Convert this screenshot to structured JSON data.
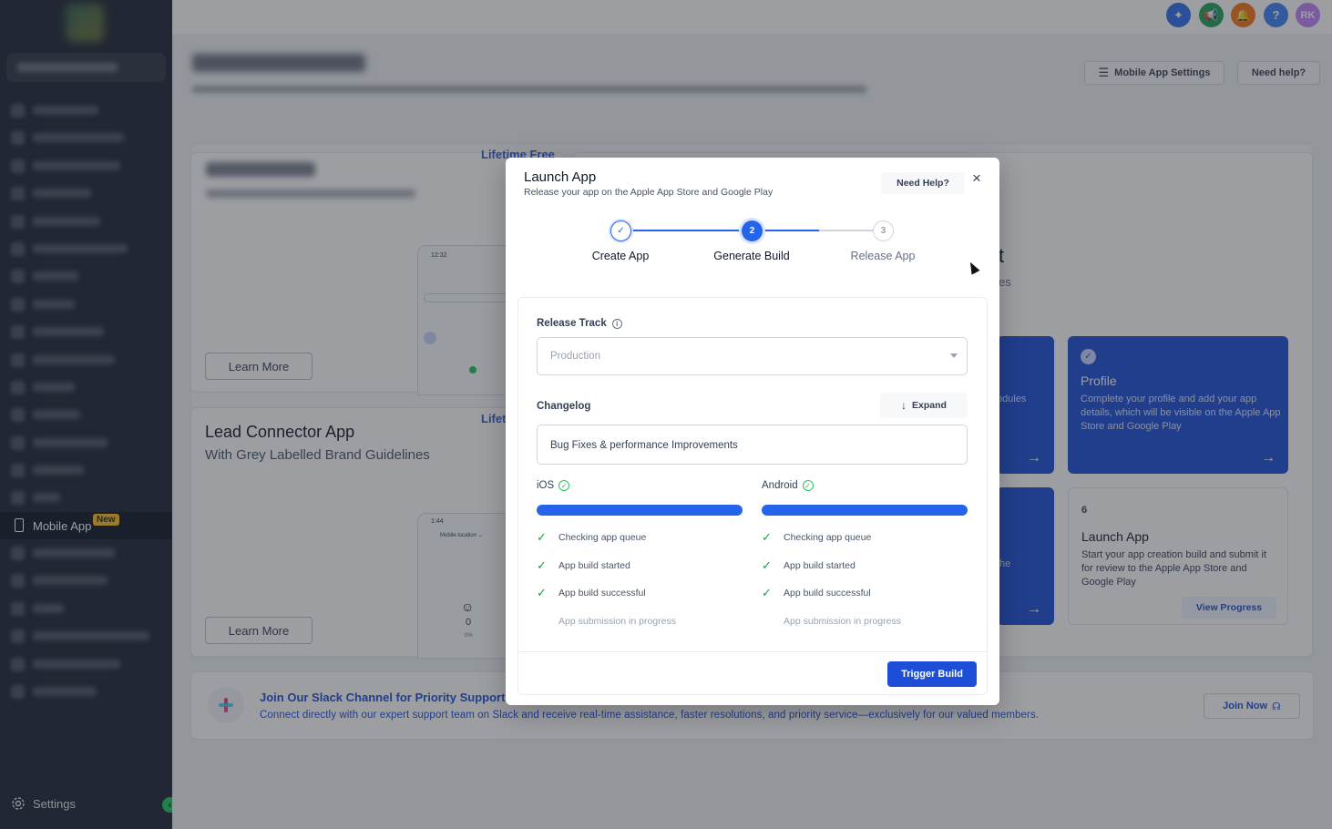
{
  "sidebar": {
    "active_item": {
      "label": "Mobile App",
      "badge": "New"
    },
    "settings_label": "Settings",
    "collapse_icon": "chevron-left-icon"
  },
  "topbar": {
    "avatar_initials": "RK",
    "help_icon": "?"
  },
  "page": {
    "settings_button": "Mobile App Settings",
    "help_button": "Need help?",
    "lifetime_free": "Lifetime Free",
    "lifetime_short": "Lifet",
    "learn_more": "Learn More",
    "learn_more_2": "Learn More",
    "lc_title": "Lead Connector App",
    "lc_subtitle": "With Grey Labelled Brand Guidelines",
    "partial_t": "t",
    "partial_es": "es",
    "partial_modules": "odules",
    "partial_the": "the",
    "phone1_time": "12:32",
    "phone2_time": "1:44",
    "phone2_location": "Mobile location ⌄",
    "phone2_value": "0",
    "phone2_percent": "0%",
    "profile_card": {
      "title": "Profile",
      "desc": "Complete your profile and add your app details, which will be visible on the Apple App Store and Google Play"
    },
    "launch_card": {
      "number": "6",
      "title": "Launch App",
      "desc": "Start your app creation build and submit it for review to the Apple App Store and Google Play",
      "button": "View Progress"
    },
    "slack": {
      "title": "Join Our Slack Channel for Priority Support!",
      "desc": "Connect directly with our expert support team on Slack and receive real-time assistance, faster resolutions, and priority service—exclusively for our valued members.",
      "button": "Join Now"
    }
  },
  "modal": {
    "title": "Launch App",
    "subtitle": "Release your app on the Apple App Store and Google Play",
    "help_button": "Need Help?",
    "close_icon": "×",
    "steps": [
      {
        "label": "Create App",
        "marker": "✓",
        "state": "done"
      },
      {
        "label": "Generate Build",
        "marker": "2",
        "state": "active"
      },
      {
        "label": "Release App",
        "marker": "3",
        "state": "upcoming"
      }
    ],
    "release_track": {
      "label": "Release Track",
      "value": "Production"
    },
    "changelog": {
      "label": "Changelog",
      "expand_button": "Expand",
      "value": "Bug Fixes & performance Improvements"
    },
    "ios": {
      "label": "iOS",
      "progress": 1.0,
      "items": [
        "Checking app queue",
        "App build started",
        "App build successful",
        "App submission in progress"
      ]
    },
    "android": {
      "label": "Android",
      "progress": 1.0,
      "items": [
        "Checking app queue",
        "App build started",
        "App build successful",
        "App submission in progress"
      ]
    },
    "trigger_button": "Trigger Build"
  },
  "colors": {
    "primary": "#1d4ed8",
    "progress": "#2563eb",
    "success": "#22c55e",
    "sidebar_bg": "#1c2434",
    "new_badge": "#fbbf24"
  }
}
